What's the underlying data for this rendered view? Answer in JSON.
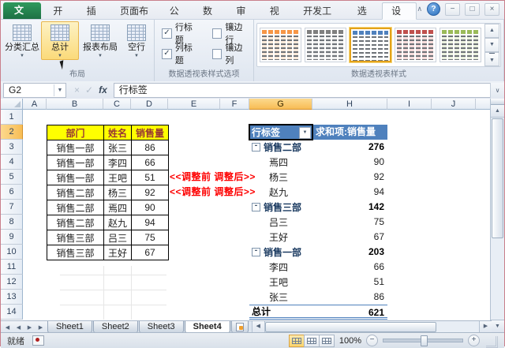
{
  "ribbon": {
    "file_tab": "文件",
    "tabs": [
      "开始",
      "插入",
      "页面布局",
      "公式",
      "数据",
      "审阅",
      "视图",
      "开发工具",
      "选项",
      "设计"
    ],
    "active_tab": "设计",
    "groups": [
      {
        "label": "布局",
        "buttons": [
          "分类汇总",
          "总计",
          "报表布局",
          "空行"
        ],
        "active_button": "总计"
      },
      {
        "label": "数据透视表样式选项",
        "checkboxes": [
          {
            "label": "行标题",
            "checked": true
          },
          {
            "label": "镶边行",
            "checked": false
          },
          {
            "label": "列标题",
            "checked": true
          },
          {
            "label": "镶边列",
            "checked": false
          }
        ]
      },
      {
        "label": "数据透视表样式",
        "styles": [
          "orange",
          "gray",
          "blue",
          "red",
          "green"
        ],
        "selected_style": "blue",
        "style_colors": {
          "orange": "#f79646",
          "gray": "#7f7f7f",
          "blue": "#4f81bd",
          "red": "#c0504d",
          "green": "#9bbb59"
        }
      }
    ]
  },
  "formula_bar": {
    "cell_ref": "G2",
    "value": "行标签"
  },
  "sheet": {
    "col_letters": [
      "A",
      "B",
      "C",
      "D",
      "E",
      "F",
      "G",
      "H",
      "I",
      "J"
    ],
    "row_numbers": [
      "1",
      "2",
      "3",
      "4",
      "5",
      "6",
      "7",
      "8",
      "9",
      "10",
      "11",
      "12",
      "13",
      "14"
    ],
    "selected_col": "G",
    "selected_row": "2",
    "source_table": {
      "headers": [
        "部门",
        "姓名",
        "销售量"
      ],
      "rows": [
        [
          "销售一部",
          "张三",
          "86"
        ],
        [
          "销售一部",
          "李四",
          "66"
        ],
        [
          "销售一部",
          "王吧",
          "51"
        ],
        [
          "销售二部",
          "杨三",
          "92"
        ],
        [
          "销售二部",
          "焉四",
          "90"
        ],
        [
          "销售二部",
          "赵九",
          "94"
        ],
        [
          "销售三部",
          "吕三",
          "75"
        ],
        [
          "销售三部",
          "王好",
          "67"
        ]
      ]
    },
    "annotations": [
      "<<调整前  调整后>>",
      "<<调整前  调整后>>"
    ],
    "pivot": {
      "row_label_header": "行标签",
      "value_header": "求和项:销售量",
      "rows": [
        {
          "label": "销售二部",
          "value": "276",
          "type": "group"
        },
        {
          "label": "焉四",
          "value": "90",
          "type": "item"
        },
        {
          "label": "杨三",
          "value": "92",
          "type": "item"
        },
        {
          "label": "赵九",
          "value": "94",
          "type": "item"
        },
        {
          "label": "销售三部",
          "value": "142",
          "type": "group"
        },
        {
          "label": "吕三",
          "value": "75",
          "type": "item"
        },
        {
          "label": "王好",
          "value": "67",
          "type": "item"
        },
        {
          "label": "销售一部",
          "value": "203",
          "type": "group"
        },
        {
          "label": "李四",
          "value": "66",
          "type": "item"
        },
        {
          "label": "王吧",
          "value": "51",
          "type": "item"
        },
        {
          "label": "张三",
          "value": "86",
          "type": "item"
        },
        {
          "label": "总计",
          "value": "621",
          "type": "total"
        }
      ]
    }
  },
  "sheet_tabs": {
    "tabs": [
      "Sheet1",
      "Sheet2",
      "Sheet3",
      "Sheet4"
    ],
    "active": "Sheet4"
  },
  "status_bar": {
    "ready": "就绪",
    "zoom": "100%",
    "view_buttons": [
      "normal",
      "page-layout",
      "page-break-preview"
    ]
  },
  "icons": {
    "dropdown": "▼",
    "up": "▲",
    "down": "▼",
    "left": "◀",
    "right": "▶",
    "check": "✓",
    "minus_box": "-",
    "help": "?",
    "collapse_ribbon": "∧",
    "expand_formula": "∨",
    "minimize": "−",
    "restore": "□",
    "close": "×",
    "fx": "fx",
    "cancel": "×",
    "enter": "✓",
    "zoom_out": "−",
    "zoom_in": "+",
    "gallery_more": "▼"
  },
  "colors": {
    "pivot_header": "#4f81bd",
    "table_header_bg": "#ffff00",
    "table_header_text": "#963634",
    "annotation": "#fe0000",
    "file_tab": "#1d7044",
    "highlight": "#fbd46b"
  }
}
